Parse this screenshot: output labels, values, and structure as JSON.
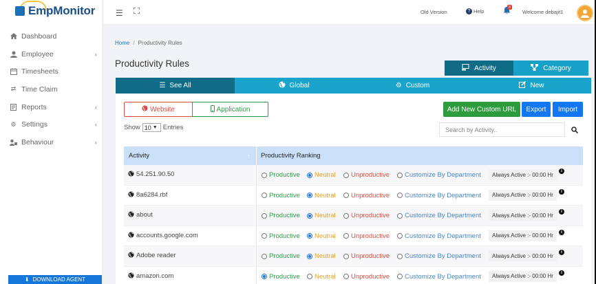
{
  "brand": {
    "name": "EmpMonitor"
  },
  "sidebar": {
    "items": [
      {
        "label": "Dashboard",
        "icon": "home-icon",
        "has_chevron": false
      },
      {
        "label": "Employee",
        "icon": "user-icon",
        "has_chevron": true
      },
      {
        "label": "Timesheets",
        "icon": "calendar-icon",
        "has_chevron": false
      },
      {
        "label": "Time Claim",
        "icon": "exchange-icon",
        "has_chevron": false
      },
      {
        "label": "Reports",
        "icon": "report-icon",
        "has_chevron": true
      },
      {
        "label": "Settings",
        "icon": "gear-icon",
        "has_chevron": true
      },
      {
        "label": "Behaviour",
        "icon": "users-icon",
        "has_chevron": true
      }
    ],
    "download_label": "DOWNLOAD AGENT"
  },
  "topbar": {
    "old_version": "Old Version",
    "help": "Help",
    "notification_count": "8",
    "welcome": "Welcome  debajit1"
  },
  "breadcrumb": {
    "home": "Home",
    "current": "Productivity Rules"
  },
  "page_title": "Productivity Rules",
  "view_switch": {
    "activity": "Activity",
    "category": "Category"
  },
  "tabs": [
    {
      "label": "See All",
      "icon": "list-icon",
      "active": true
    },
    {
      "label": "Global",
      "icon": "globe-icon",
      "active": false
    },
    {
      "label": "Custom",
      "icon": "cogs-icon",
      "active": false
    },
    {
      "label": "New",
      "icon": "edit-icon",
      "active": false
    }
  ],
  "filter_toggle": {
    "website": "Website",
    "application": "Application"
  },
  "buttons": {
    "add_custom_url": "Add New Custom URL",
    "export": "Export",
    "import": "Import"
  },
  "table_controls": {
    "show": "Show",
    "entries_value": "10",
    "entries": "Entries",
    "search_placeholder": "Search by Activity.."
  },
  "table": {
    "headers": {
      "activity": "Activity",
      "ranking": "Productivity Ranking"
    },
    "options": {
      "productive": "Productive",
      "neutral": "Neutral",
      "unproductive": "Unproductive",
      "custom": "Customize By Department"
    },
    "always_active": "Always Active :- 00:00 Hr",
    "rows": [
      {
        "activity": "54.251.90.50",
        "selected": "neutral"
      },
      {
        "activity": "8a6284.rbf",
        "selected": "neutral"
      },
      {
        "activity": "about",
        "selected": "neutral"
      },
      {
        "activity": "accounts.google.com",
        "selected": "neutral"
      },
      {
        "activity": "Adobe reader",
        "selected": "neutral"
      },
      {
        "activity": "amazon.com",
        "selected": "productive"
      }
    ]
  },
  "colors": {
    "primary_dark": "#0f6b86",
    "primary": "#1aa4cb",
    "productive": "#2f9b48",
    "neutral": "#e7a02e",
    "unproductive": "#d84b3e",
    "custom": "#4a86c8"
  }
}
